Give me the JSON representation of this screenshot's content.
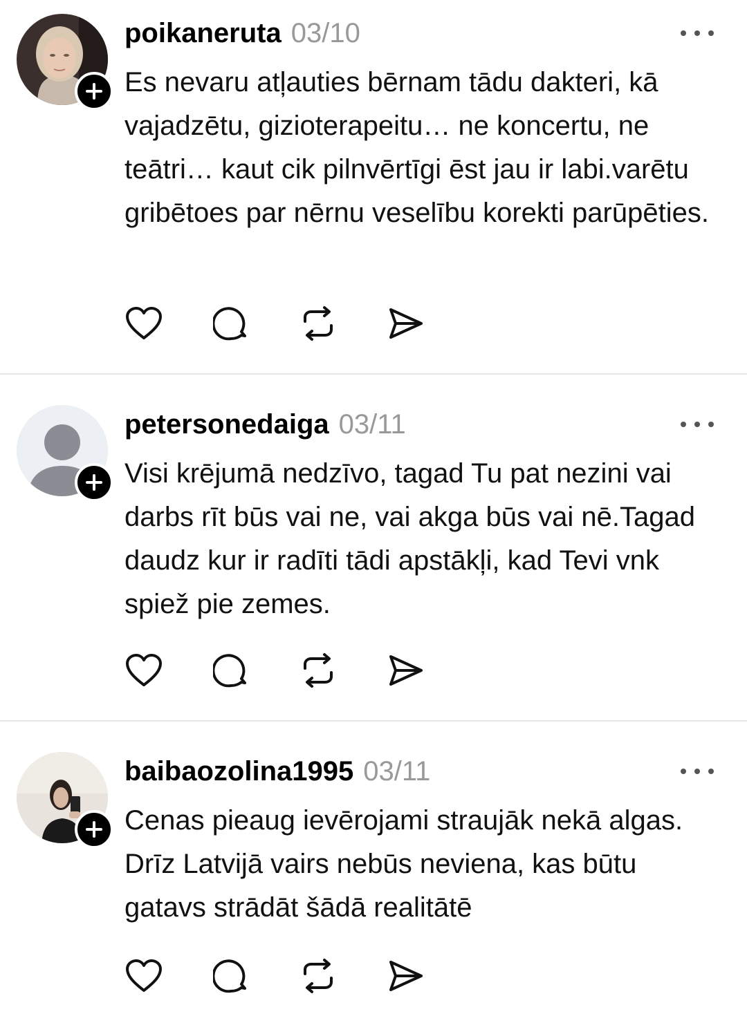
{
  "posts": [
    {
      "username": "poikaneruta",
      "date": "03/10",
      "text": "Es nevaru atļauties bērnam tādu dakteri, kā vajadzētu, gizioterapeitu… ne koncertu, ne teātri… kaut cik pilnvērtīgi ēst jau ir labi.varētu gribētoes par nērnu veselību korekti parūpēties.",
      "avatar": "photo-woman-blonde"
    },
    {
      "username": "petersonedaiga",
      "date": "03/11",
      "text": "Visi krējumā nedzīvo, tagad Tu pat nezini vai darbs rīt būs vai ne, vai akga būs vai nē.Tagad daudz kur ir radīti tādi apstākļi, kad Tevi vnk spiež pie zemes.",
      "avatar": "default-person"
    },
    {
      "username": "baibaozolina1995",
      "date": "03/11",
      "text": "Cenas pieaug ievērojami straujāk nekā algas. Drīz Latvijā vairs nebūs neviena, kas būtu gatavs strādāt šādā realitātē",
      "avatar": "photo-woman-mirror-selfie"
    }
  ],
  "icons": {
    "like": "heart-icon",
    "reply": "comment-icon",
    "repost": "repost-icon",
    "share": "send-icon",
    "more": "more-icon",
    "follow": "plus-icon"
  }
}
